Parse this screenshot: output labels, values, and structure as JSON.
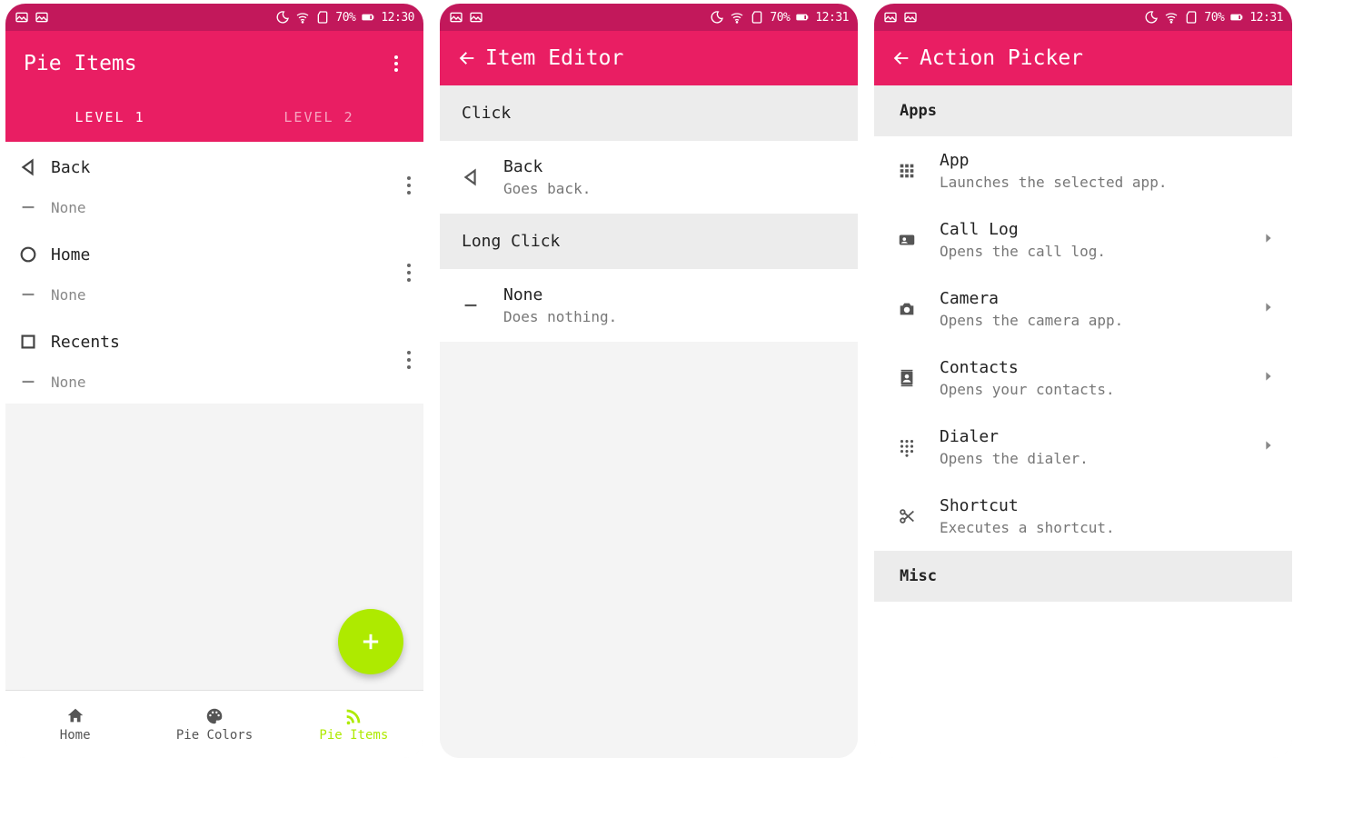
{
  "status": {
    "battery": "70%",
    "time_a": "12:30",
    "time_b": "12:31"
  },
  "screen1": {
    "title": "Pie Items",
    "tabs": [
      "LEVEL 1",
      "LEVEL 2"
    ],
    "items": [
      {
        "primary": "Back",
        "secondary": "None"
      },
      {
        "primary": "Home",
        "secondary": "None"
      },
      {
        "primary": "Recents",
        "secondary": "None"
      }
    ],
    "bottom_nav": [
      "Home",
      "Pie Colors",
      "Pie Items"
    ]
  },
  "screen2": {
    "title": "Item Editor",
    "sections": {
      "click": {
        "label": "Click",
        "item": {
          "title": "Back",
          "subtitle": "Goes back."
        }
      },
      "long_click": {
        "label": "Long Click",
        "item": {
          "title": "None",
          "subtitle": "Does nothing."
        }
      }
    }
  },
  "screen3": {
    "title": "Action Picker",
    "groups": {
      "apps": {
        "label": "Apps",
        "items": [
          {
            "title": "App",
            "subtitle": "Launches the selected app.",
            "chevron": false
          },
          {
            "title": "Call Log",
            "subtitle": "Opens the call log.",
            "chevron": true
          },
          {
            "title": "Camera",
            "subtitle": "Opens the camera app.",
            "chevron": true
          },
          {
            "title": "Contacts",
            "subtitle": "Opens your contacts.",
            "chevron": true
          },
          {
            "title": "Dialer",
            "subtitle": "Opens the dialer.",
            "chevron": true
          },
          {
            "title": "Shortcut",
            "subtitle": "Executes a shortcut.",
            "chevron": false
          }
        ]
      },
      "misc": {
        "label": "Misc"
      }
    }
  }
}
